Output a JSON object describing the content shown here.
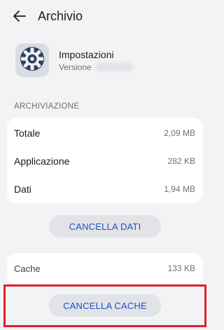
{
  "header": {
    "title": "Archivio",
    "back_icon": "arrow-left-icon"
  },
  "app": {
    "name": "Impostazioni",
    "version_label": "Versione",
    "icon": "gear-icon"
  },
  "storage": {
    "section_label": "ARCHIVIAZIONE",
    "rows": [
      {
        "label": "Totale",
        "value": "2,09 MB"
      },
      {
        "label": "Applicazione",
        "value": "282 KB"
      },
      {
        "label": "Dati",
        "value": "1,94 MB"
      }
    ]
  },
  "actions": {
    "clear_data_label": "CANCELLA DATI",
    "clear_cache_label": "CANCELLA CACHE"
  },
  "cache": {
    "label": "Cache",
    "value": "133 KB"
  },
  "colors": {
    "accent": "#1f4fcc",
    "highlight": "#e41e2a",
    "background": "#f1f3f5"
  }
}
